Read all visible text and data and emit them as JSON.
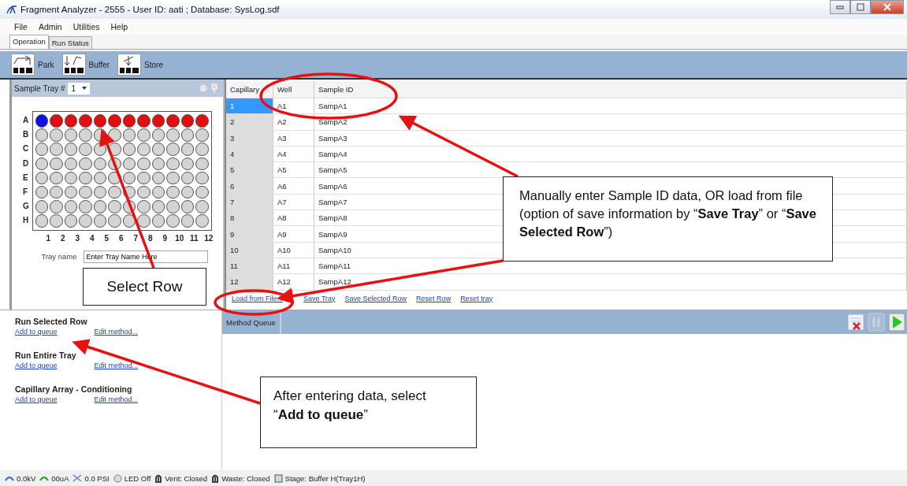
{
  "window": {
    "title": "Fragment Analyzer - 2555 - User ID: aati ; Database: SysLog.sdf"
  },
  "menu": [
    "File",
    "Admin",
    "Utilities",
    "Help"
  ],
  "tabs": [
    {
      "label": "Operation",
      "selected": true
    },
    {
      "label": "Run Status",
      "selected": false
    }
  ],
  "toolbar": [
    {
      "label": "Park",
      "kind": "park"
    },
    {
      "label": "Buffer",
      "kind": "buffer"
    },
    {
      "label": "Store",
      "kind": "store"
    }
  ],
  "sample_tray": {
    "label": "Sample Tray #",
    "value": "1",
    "row_labels": [
      "A",
      "B",
      "C",
      "D",
      "E",
      "F",
      "G",
      "H"
    ],
    "column_labels": [
      "1",
      "2",
      "3",
      "4",
      "5",
      "6",
      "7",
      "8",
      "9",
      "10",
      "11",
      "12"
    ],
    "wells": [
      [
        {
          "color": "#1010e0"
        },
        {
          "color": "#e01010"
        },
        {
          "color": "#e01010"
        },
        {
          "color": "#e01010"
        },
        {
          "color": "#e01010"
        },
        {
          "color": "#e01010"
        },
        {
          "color": "#e01010"
        },
        {
          "color": "#e01010"
        },
        {
          "color": "#e01010"
        },
        {
          "color": "#e01010"
        },
        {
          "color": "#e01010"
        },
        {
          "color": "#e01010"
        }
      ],
      [
        {
          "color": "#d4d4d4"
        },
        {
          "color": "#d4d4d4"
        },
        {
          "color": "#d4d4d4"
        },
        {
          "color": "#d4d4d4"
        },
        {
          "color": "#d4d4d4"
        },
        {
          "color": "#d4d4d4"
        },
        {
          "color": "#d4d4d4"
        },
        {
          "color": "#d4d4d4"
        },
        {
          "color": "#d4d4d4"
        },
        {
          "color": "#d4d4d4"
        },
        {
          "color": "#d4d4d4"
        },
        {
          "color": "#d4d4d4"
        }
      ],
      [
        {
          "color": "#d4d4d4"
        },
        {
          "color": "#d4d4d4"
        },
        {
          "color": "#d4d4d4"
        },
        {
          "color": "#d4d4d4"
        },
        {
          "color": "#d4d4d4"
        },
        {
          "color": "#d4d4d4"
        },
        {
          "color": "#d4d4d4"
        },
        {
          "color": "#d4d4d4"
        },
        {
          "color": "#d4d4d4"
        },
        {
          "color": "#d4d4d4"
        },
        {
          "color": "#d4d4d4"
        },
        {
          "color": "#d4d4d4"
        }
      ],
      [
        {
          "color": "#d4d4d4"
        },
        {
          "color": "#d4d4d4"
        },
        {
          "color": "#d4d4d4"
        },
        {
          "color": "#d4d4d4"
        },
        {
          "color": "#d4d4d4"
        },
        {
          "color": "#d4d4d4"
        },
        {
          "color": "#d4d4d4"
        },
        {
          "color": "#d4d4d4"
        },
        {
          "color": "#d4d4d4"
        },
        {
          "color": "#d4d4d4"
        },
        {
          "color": "#d4d4d4"
        },
        {
          "color": "#d4d4d4"
        }
      ],
      [
        {
          "color": "#d4d4d4"
        },
        {
          "color": "#d4d4d4"
        },
        {
          "color": "#d4d4d4"
        },
        {
          "color": "#d4d4d4"
        },
        {
          "color": "#d4d4d4"
        },
        {
          "color": "#d4d4d4"
        },
        {
          "color": "#d4d4d4"
        },
        {
          "color": "#d4d4d4"
        },
        {
          "color": "#d4d4d4"
        },
        {
          "color": "#d4d4d4"
        },
        {
          "color": "#d4d4d4"
        },
        {
          "color": "#d4d4d4"
        }
      ],
      [
        {
          "color": "#d4d4d4"
        },
        {
          "color": "#d4d4d4"
        },
        {
          "color": "#d4d4d4"
        },
        {
          "color": "#d4d4d4"
        },
        {
          "color": "#d4d4d4"
        },
        {
          "color": "#d4d4d4"
        },
        {
          "color": "#d4d4d4"
        },
        {
          "color": "#d4d4d4"
        },
        {
          "color": "#d4d4d4"
        },
        {
          "color": "#d4d4d4"
        },
        {
          "color": "#d4d4d4"
        },
        {
          "color": "#d4d4d4"
        }
      ],
      [
        {
          "color": "#d4d4d4"
        },
        {
          "color": "#d4d4d4"
        },
        {
          "color": "#d4d4d4"
        },
        {
          "color": "#d4d4d4"
        },
        {
          "color": "#d4d4d4"
        },
        {
          "color": "#d4d4d4"
        },
        {
          "color": "#d4d4d4"
        },
        {
          "color": "#d4d4d4"
        },
        {
          "color": "#d4d4d4"
        },
        {
          "color": "#d4d4d4"
        },
        {
          "color": "#d4d4d4"
        },
        {
          "color": "#d4d4d4"
        }
      ],
      [
        {
          "color": "#d4d4d4"
        },
        {
          "color": "#d4d4d4"
        },
        {
          "color": "#d4d4d4"
        },
        {
          "color": "#d4d4d4"
        },
        {
          "color": "#d4d4d4"
        },
        {
          "color": "#d4d4d4"
        },
        {
          "color": "#d4d4d4"
        },
        {
          "color": "#d4d4d4"
        },
        {
          "color": "#d4d4d4"
        },
        {
          "color": "#d4d4d4"
        },
        {
          "color": "#d4d4d4"
        },
        {
          "color": "#d4d4d4"
        }
      ]
    ],
    "tray_name_label": "Tray name",
    "tray_name_value": "Enter Tray Name Here"
  },
  "table": {
    "columns": [
      "Capillary",
      "Well",
      "Sample ID"
    ],
    "rows": [
      {
        "capillary": "1",
        "well": "A1",
        "sample_id": "SampA1",
        "selected": true
      },
      {
        "capillary": "2",
        "well": "A2",
        "sample_id": "SampA2",
        "selected": false
      },
      {
        "capillary": "3",
        "well": "A3",
        "sample_id": "SampA3",
        "selected": false
      },
      {
        "capillary": "4",
        "well": "A4",
        "sample_id": "SampA4",
        "selected": false
      },
      {
        "capillary": "5",
        "well": "A5",
        "sample_id": "SampA5",
        "selected": false
      },
      {
        "capillary": "6",
        "well": "A6",
        "sample_id": "SampA6",
        "selected": false
      },
      {
        "capillary": "7",
        "well": "A7",
        "sample_id": "SampA7",
        "selected": false
      },
      {
        "capillary": "8",
        "well": "A8",
        "sample_id": "SampA8",
        "selected": false
      },
      {
        "capillary": "9",
        "well": "A9",
        "sample_id": "SampA9",
        "selected": false
      },
      {
        "capillary": "10",
        "well": "A10",
        "sample_id": "SampA10",
        "selected": false
      },
      {
        "capillary": "11",
        "well": "A11",
        "sample_id": "SampA11",
        "selected": false
      },
      {
        "capillary": "12",
        "well": "A12",
        "sample_id": "SampA12",
        "selected": false
      }
    ],
    "links": [
      "Load from File...",
      "Save Tray",
      "Save Selected Row",
      "Reset Row",
      "Reset tray"
    ]
  },
  "methods": [
    {
      "title": "Run Selected Row",
      "add": "Add to queue",
      "edit": "Edit method..."
    },
    {
      "title": "Run Entire Tray",
      "add": "Add to queue",
      "edit": "Edit method..."
    },
    {
      "title": "Capillary Array - Conditioning",
      "add": "Add to queue",
      "edit": "Edit method..."
    }
  ],
  "method_queue": {
    "label": "Method Queue"
  },
  "status_bar": [
    {
      "text": "0.0kV",
      "kind": "voltage"
    },
    {
      "text": "00uA",
      "kind": "current"
    },
    {
      "text": "0.0 PSI",
      "kind": "pressure"
    },
    {
      "text": "LED Off",
      "kind": "led"
    },
    {
      "text": "Vent: Closed",
      "kind": "valve"
    },
    {
      "text": "Waste: Closed",
      "kind": "valve"
    },
    {
      "text": "Stage: Buffer H(Tray1H)",
      "kind": "stage"
    }
  ],
  "annotations": [
    {
      "text": "Select Row"
    },
    {
      "text": "Manually enter Sample ID data, OR load from file (option of save information by “**Save Tray**” or “**Save Selected Row**”)"
    },
    {
      "text": "After entering data, select “**Add to queue**”"
    }
  ]
}
